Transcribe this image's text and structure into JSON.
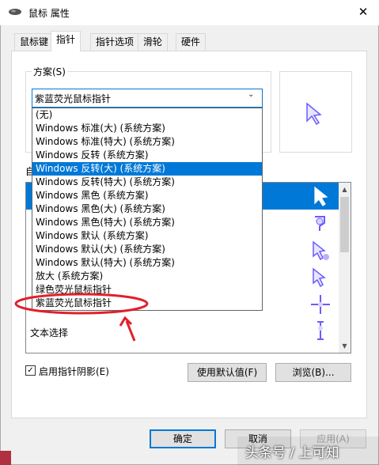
{
  "window": {
    "title": "鼠标 属性",
    "close_glyph": "✕"
  },
  "tabs": [
    {
      "label": "鼠标键",
      "active": false
    },
    {
      "label": "指针",
      "active": true
    },
    {
      "label": "指针选项",
      "active": false
    },
    {
      "label": "滑轮",
      "active": false
    },
    {
      "label": "硬件",
      "active": false
    }
  ],
  "scheme": {
    "group_label": "方案(S)",
    "selected_value": "紫蓝荧光鼠标指针",
    "options": [
      "(无)",
      "Windows 标准(大) (系统方案)",
      "Windows 标准(特大) (系统方案)",
      "Windows 反转 (系统方案)",
      "Windows 反转(大) (系统方案)",
      "Windows 反转(特大) (系统方案)",
      "Windows 黑色 (系统方案)",
      "Windows 黑色(大) (系统方案)",
      "Windows 黑色(特大) (系统方案)",
      "Windows 默认 (系统方案)",
      "Windows 默认(大) (系统方案)",
      "Windows 默认(特大) (系统方案)",
      "放大 (系统方案)",
      "绿色荧光鼠标指针",
      "紫蓝荧光鼠标指针"
    ],
    "highlighted_index": 4
  },
  "customize": {
    "label": "自",
    "rows": [
      {
        "label": ""
      },
      {
        "label": ""
      },
      {
        "label": ""
      },
      {
        "label": ""
      },
      {
        "label": ""
      },
      {
        "label": ""
      },
      {
        "label": "文本选择"
      }
    ]
  },
  "pointer_shadow": {
    "label": "启用指针阴影(E)",
    "checked": true,
    "check_glyph": "✓"
  },
  "buttons": {
    "use_default": "使用默认值(F)",
    "browse": "浏览(B)...",
    "ok": "确定",
    "cancel": "取消",
    "apply": "应用(A)"
  },
  "watermark": "头条号 / 上可知",
  "colors": {
    "accent": "#0078d7",
    "cursor": "#6a5cff",
    "annotation": "#e0202c"
  }
}
